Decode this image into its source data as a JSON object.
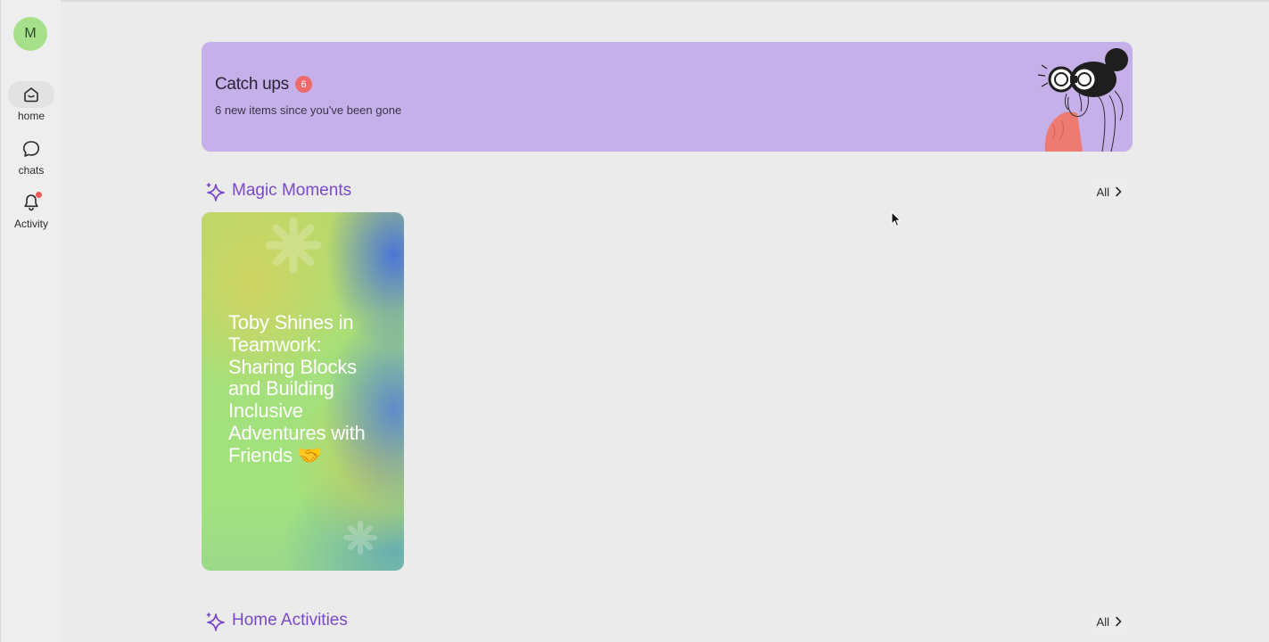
{
  "user": {
    "avatar_initial": "M"
  },
  "sidebar": {
    "items": [
      {
        "label": "home",
        "icon": "home-icon",
        "active": true
      },
      {
        "label": "chats",
        "icon": "chat-bubble-icon",
        "active": false
      },
      {
        "label": "Activity",
        "icon": "bell-icon",
        "active": false,
        "has_notification": true
      }
    ]
  },
  "catchups": {
    "title": "Catch ups",
    "count": "6",
    "subtitle": "6 new items since you've been gone",
    "illustration": "person-with-binoculars-illustration"
  },
  "magic_moments": {
    "title": "Magic Moments",
    "all_label": "All",
    "cards": [
      {
        "title": "Toby Shines in Teamwork: Sharing Blocks and Building Inclusive Adventures with Friends 🤝"
      }
    ]
  },
  "home_activities": {
    "title": "Home Activities",
    "all_label": "All"
  },
  "colors": {
    "background": "#ebebeb",
    "catchup_banner": "#c5b0ea",
    "section_title": "#7a49c9",
    "badge": "#ef6a6a",
    "avatar": "#a7e08a"
  }
}
